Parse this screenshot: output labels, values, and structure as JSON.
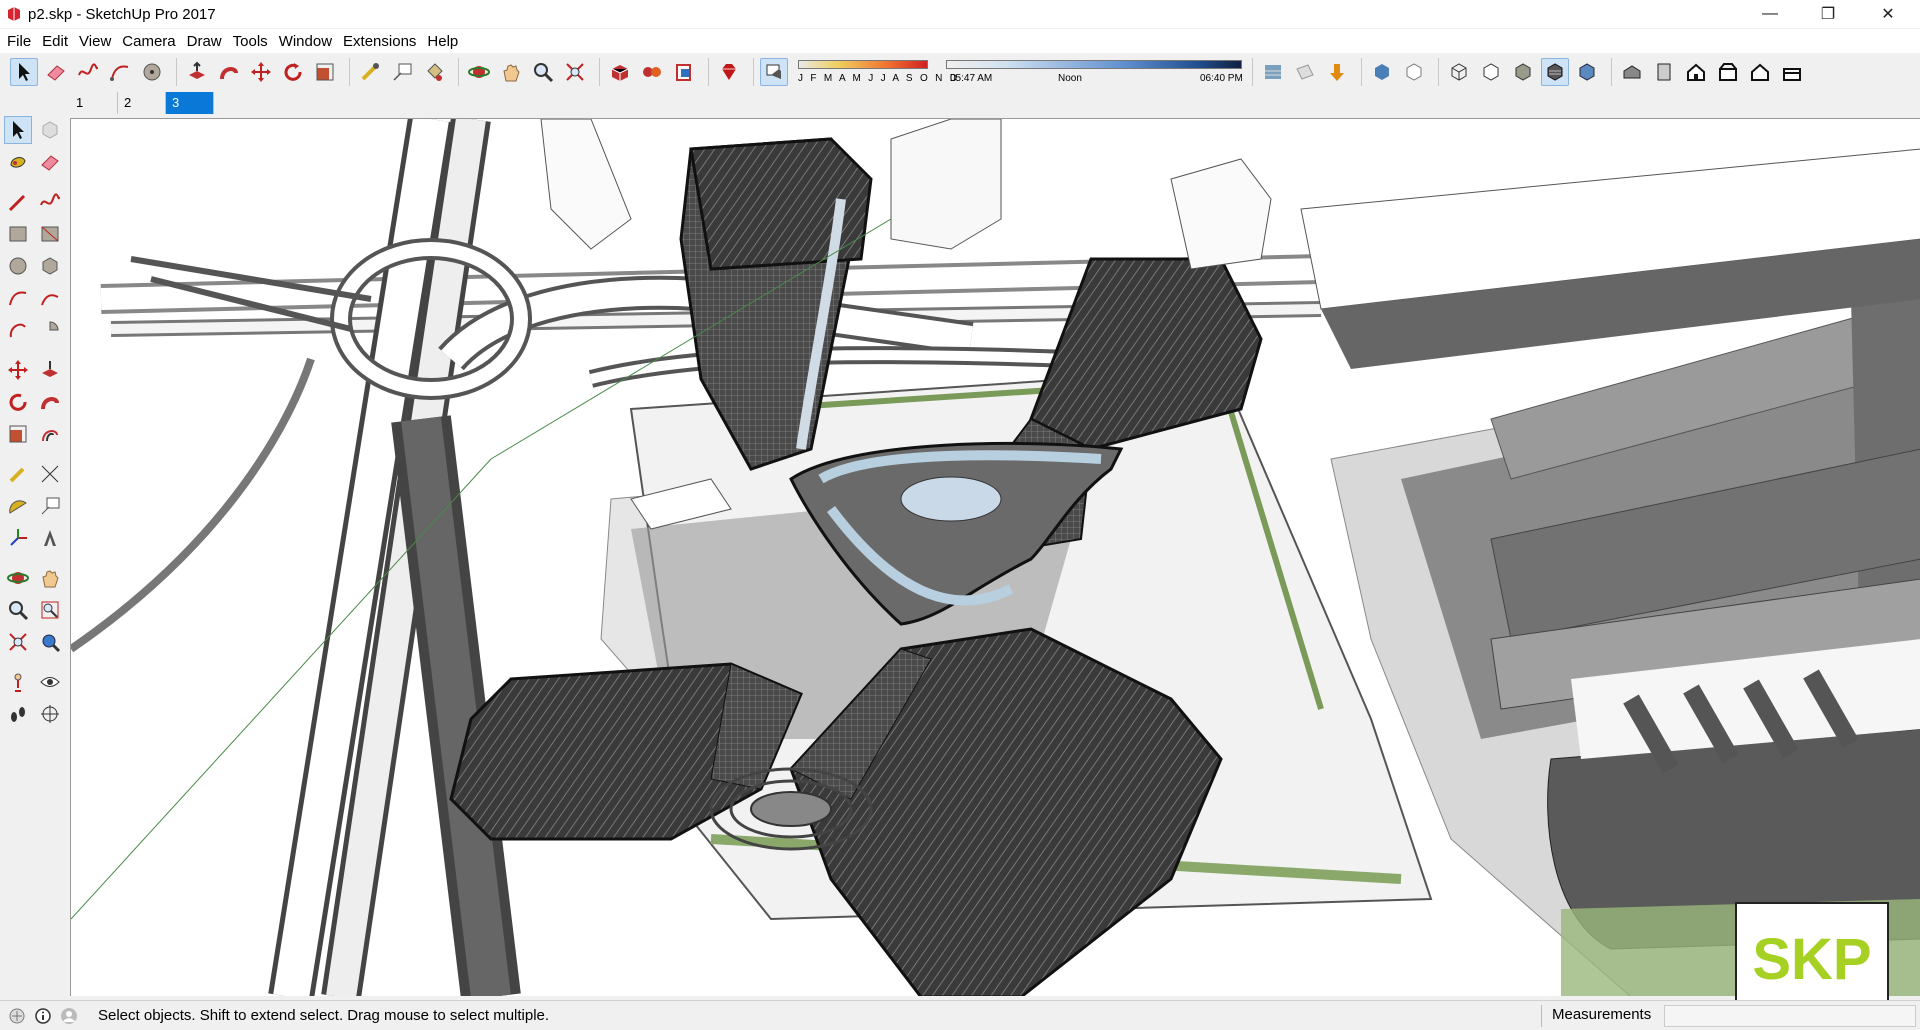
{
  "window": {
    "title": "p2.skp - SketchUp Pro 2017",
    "minimize": "—",
    "restore": "❐",
    "close": "✕"
  },
  "menu": [
    "File",
    "Edit",
    "View",
    "Camera",
    "Draw",
    "Tools",
    "Window",
    "Extensions",
    "Help"
  ],
  "shadow": {
    "months": "J F M A M J J A S O N D",
    "time_start": "05:47 AM",
    "time_mid": "Noon",
    "time_end": "06:40 PM"
  },
  "scenes": [
    {
      "label": "1",
      "active": false
    },
    {
      "label": "2",
      "active": false
    },
    {
      "label": "3",
      "active": true
    }
  ],
  "status": {
    "message": "Select objects. Shift to extend select. Drag mouse to select multiple.",
    "measurements_label": "Measurements",
    "measurements_value": ""
  },
  "watermark": "SKP",
  "colors": {
    "accent": "#0a78d7",
    "sketchup_red": "#d5232f",
    "watermark_green": "#a6d122"
  },
  "icons": {
    "toolbar": [
      "select-arrow-icon",
      "eraser-icon",
      "freehand-icon",
      "arc-icon",
      "circle-icon",
      "push-pull-icon",
      "follow-me-icon",
      "move-icon",
      "rotate-icon",
      "scale-icon",
      "tape-measure-icon",
      "text-icon",
      "paint-bucket-icon",
      "orbit-icon",
      "pan-icon",
      "zoom-icon",
      "zoom-extents-icon",
      "warehouse-icon",
      "extension-warehouse-icon",
      "layout-icon",
      "ruby-icon",
      "shadow-toggle-icon",
      "fog-icon",
      "xray-icon",
      "back-edges-icon",
      "wireframe-icon",
      "hidden-line-icon",
      "shaded-icon",
      "textured-icon",
      "monochrome-icon",
      "iso-view-icon",
      "top-view-icon",
      "front-view-icon",
      "right-view-icon",
      "back-view-icon",
      "left-view-icon"
    ]
  }
}
